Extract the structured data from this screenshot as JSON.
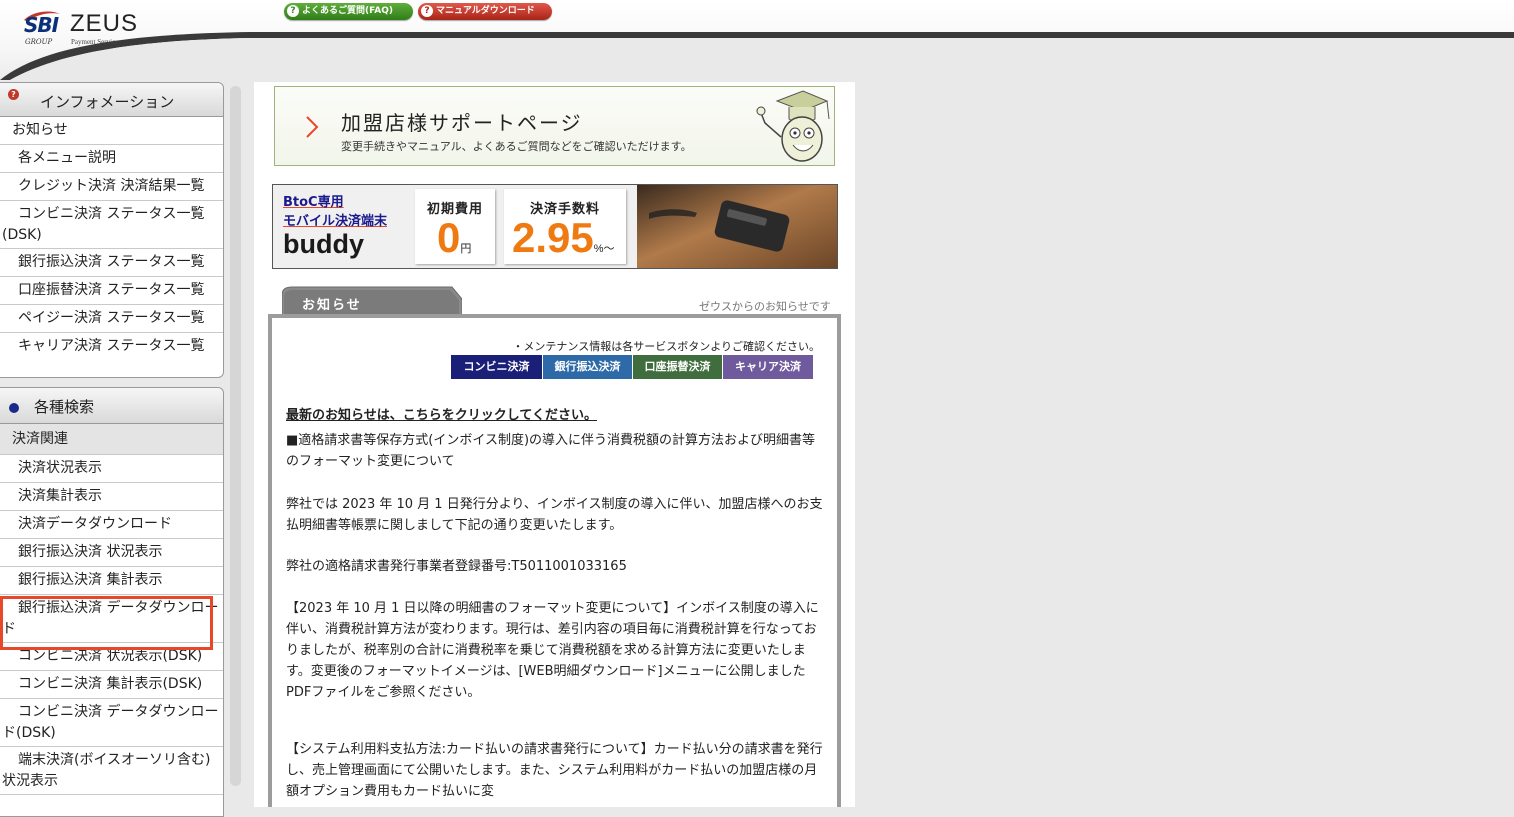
{
  "header": {
    "logo": {
      "sbi": "SBI",
      "group": "GROUP",
      "zeus": "ZEUS",
      "subtitle": "Payment Service"
    },
    "faq_button": "よくあるご質問(FAQ)",
    "manual_button": "マニュアルダウンロード",
    "question_mark": "?"
  },
  "sidebar": {
    "info": {
      "title": "インフォメーション",
      "icon": "?",
      "items": [
        "お知らせ",
        "各メニュー説明",
        "クレジット決済 決済結果一覧",
        "コンビニ決済 ステータス一覧(DSK)",
        "銀行振込決済 ステータス一覧",
        "口座振替決済 ステータス一覧",
        "ペイジー決済 ステータス一覧",
        "キャリア決済 ステータス一覧"
      ]
    },
    "search": {
      "title": "各種検索",
      "category": "決済関連",
      "items": [
        "決済状況表示",
        "決済集計表示",
        "決済データダウンロード",
        "銀行振込決済 状況表示",
        "銀行振込決済 集計表示",
        "銀行振込決済 データダウンロード",
        "コンビニ決済 状況表示(DSK)",
        "コンビニ決済 集計表示(DSK)",
        "コンビニ決済 データダウンロード(DSK)",
        "端末決済(ボイスオーソリ含む)状況表示"
      ]
    }
  },
  "main": {
    "support_banner": {
      "title": "加盟店様サポートページ",
      "subtitle": "変更手続きやマニュアル、よくあるご質問などをご確認いただけます。"
    },
    "buddy_banner": {
      "line1": "BtoC専用",
      "line2": "モバイル決済端末",
      "name": "buddy",
      "fee_caption": "初期費用",
      "fee_value": "0",
      "fee_unit": "円",
      "rate_caption": "決済手数料",
      "rate_value": "2.95",
      "rate_unit": "%～"
    },
    "notice": {
      "tab_label": "お知らせ",
      "tab_right": "ゼウスからのお知らせです",
      "maintenance": "・メンテナンス情報は各サービスボタンよりご確認ください。",
      "buttons": [
        "コンビニ決済",
        "銀行振込決済",
        "口座振替決済",
        "キャリア決済"
      ],
      "latest_link": "最新のお知らせは、こちらをクリックしてください。",
      "paragraphs": [
        "■適格請求書等保存方式(インボイス制度)の導入に伴う消費税額の計算方法および明細書等のフォーマット変更について",
        "弊社では 2023 年 10 月 1 日発行分より、インボイス制度の導入に伴い、加盟店様へのお支払明細書等帳票に関しまして下記の通り変更いたします。",
        "弊社の適格請求書発行事業者登録番号:T5011001033165",
        "【2023 年 10 月 1 日以降の明細書のフォーマット変更について】インボイス制度の導入に伴い、消費税計算方法が変わります。現行は、差引内容の項目毎に消費税計算を行なっておりましたが、税率別の合計に消費税率を乗じて消費税額を求める計算方法に変更いたします。変更後のフォーマットイメージは、[WEB明細ダウンロード]メニューに公開しましたPDFファイルをご参照ください。",
        "【システム利用料支払方法:カード払いの請求書発行について】カード払い分の請求書を発行し、売上管理画面にて公開いたします。また、システム利用料がカード払いの加盟店様の月額オプション費用もカード払いに変"
      ]
    }
  },
  "colors": {
    "highlight": "#e8482a",
    "faq_green": "#3a8a22",
    "manual_red": "#b3271b",
    "accent_orange": "#f07a12"
  }
}
